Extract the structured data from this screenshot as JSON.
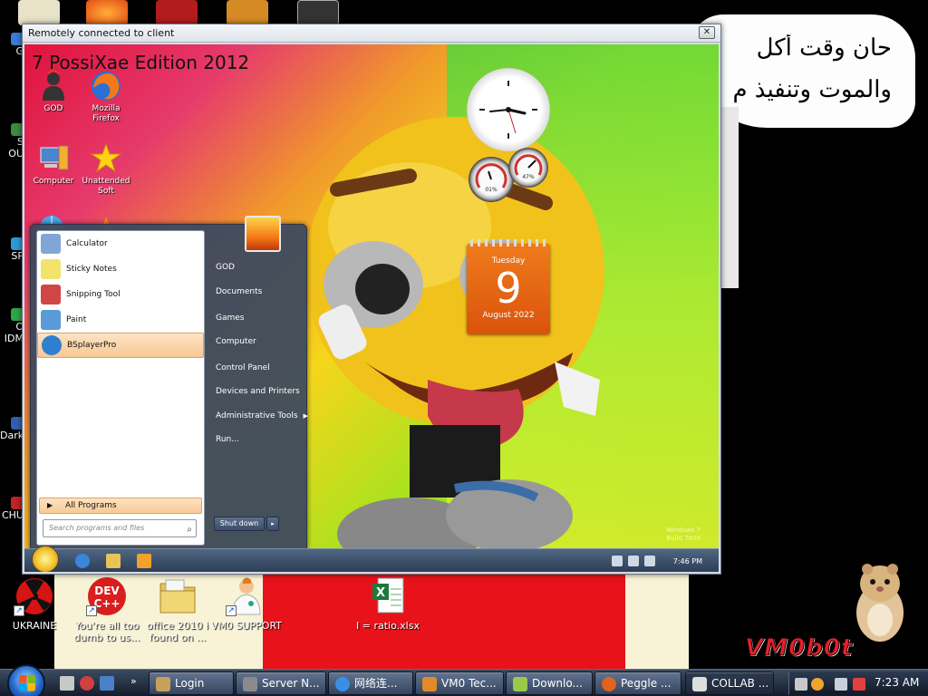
{
  "host": {
    "arabic_line_1": "حان وقت أكل",
    "arabic_line_2": "والموت وتنفيذ م",
    "left_icons": [
      "G",
      "S OU",
      "SP",
      "O IDM",
      "Dark",
      "CHU"
    ],
    "desktop_icons": [
      {
        "label": "UKRAINE",
        "icon": "radiation-icon"
      },
      {
        "label": "You're all too dumb to us...",
        "icon": "dev-cpp-icon"
      },
      {
        "label": "office 2010 i found on ...",
        "icon": "folder-icon"
      },
      {
        "label": "VM0 SUPPORT",
        "icon": "support-person-icon"
      },
      {
        "label": "I = ratio.xlsx",
        "icon": "excel-file-icon"
      }
    ],
    "logo_text": "VM0b0t"
  },
  "remote_window": {
    "title": "Remotely connected to client",
    "close_label": "✕",
    "watermark": "7 PossiXae Edition 2012",
    "desktop_icons": [
      {
        "label": "GOD",
        "icon": "user-icon"
      },
      {
        "label": "Mozilla Firefox",
        "icon": "firefox-icon"
      },
      {
        "label": "Computer",
        "icon": "computer-icon"
      },
      {
        "label": "Unattended Soft",
        "icon": "star-icon"
      }
    ],
    "calendar": {
      "day": "Tuesday",
      "date": "9",
      "month": "August 2022"
    },
    "gauges": [
      {
        "label": "01%"
      },
      {
        "label": "47%"
      }
    ],
    "corner_text": [
      "Windows 7",
      "Build 7600"
    ],
    "start_menu": {
      "programs": [
        {
          "label": "Calculator",
          "icon": "calculator-icon",
          "color": "#7fa6d6"
        },
        {
          "label": "Sticky Notes",
          "icon": "sticky-notes-icon",
          "color": "#f2e46a"
        },
        {
          "label": "Snipping Tool",
          "icon": "scissors-icon",
          "color": "#d04646"
        },
        {
          "label": "Paint",
          "icon": "paint-icon",
          "color": "#5a9ad8"
        },
        {
          "label": "BSplayerPro",
          "icon": "bsplayer-icon",
          "color": "#2f7fd0"
        }
      ],
      "all_programs": "All Programs",
      "search_placeholder": "Search programs and files",
      "right_items": [
        {
          "label": "GOD"
        },
        {
          "label": "Documents"
        },
        {
          "label": "Games"
        },
        {
          "label": "Computer"
        },
        {
          "label": "Control Panel"
        },
        {
          "label": "Devices and Printers"
        },
        {
          "label": "Administrative Tools",
          "submenu": "▶"
        },
        {
          "label": "Run..."
        }
      ],
      "shutdown": "Shut down",
      "shutdown_arrow": "▸"
    },
    "taskbar": {
      "clock": "7:46 PM"
    }
  },
  "host_taskbar": {
    "tasks": [
      {
        "label": "Login",
        "icon": "login-icon",
        "color": "#c9a05a"
      },
      {
        "label": "Server N...",
        "icon": "server-icon",
        "color": "#8a8a8a"
      },
      {
        "label": "网络连...",
        "icon": "chrome-icon",
        "color": "#3a8ee6"
      },
      {
        "label": "VM0 Tec...",
        "icon": "support-person-icon",
        "color": "#e08a2c"
      },
      {
        "label": "Downlo...",
        "icon": "download-icon",
        "color": "#9bc94b"
      },
      {
        "label": "Peggle ...",
        "icon": "peggle-icon",
        "color": "#e0641c"
      },
      {
        "label": "COLLAB ...",
        "icon": "collab-icon",
        "color": "#dddddd"
      }
    ],
    "clock": "7:23 AM",
    "chevron": "»"
  }
}
